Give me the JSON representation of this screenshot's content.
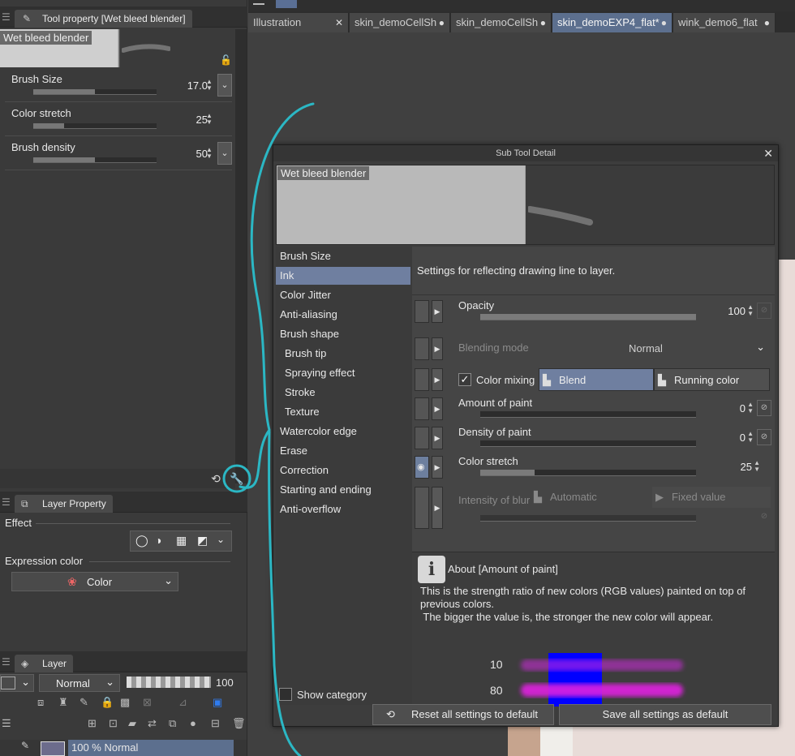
{
  "tool_property": {
    "tab_title": "Tool property [Wet bleed blender]",
    "preview_label": "Wet bleed blender",
    "props": [
      {
        "label": "Brush Size",
        "value": "17.0",
        "fill": 0.5
      },
      {
        "label": "Color stretch",
        "value": "25",
        "fill": 0.25
      },
      {
        "label": "Brush density",
        "value": "50",
        "fill": 0.5
      }
    ]
  },
  "layer_property": {
    "tab_title": "Layer Property",
    "effect_label": "Effect",
    "expression_label": "Expression color",
    "expression_value": "Color"
  },
  "layer_panel": {
    "tab_title": "Layer",
    "blend_mode": "Normal",
    "opacity": "100",
    "layer_row": "100 % Normal"
  },
  "doc_tabs": [
    {
      "label": "Illustration",
      "close": "✕",
      "active": false
    },
    {
      "label": "skin_demoCellSh",
      "close": "●",
      "active": false
    },
    {
      "label": "skin_demoCellSh",
      "close": "●",
      "active": false
    },
    {
      "label": "skin_demoEXP4_flat*",
      "close": "●",
      "active": true
    },
    {
      "label": "wink_demo6_flat",
      "close": "●",
      "active": false
    }
  ],
  "dialog": {
    "title": "Sub Tool Detail",
    "preview_label": "Wet bleed blender",
    "categories": [
      {
        "label": "Brush Size",
        "sub": false,
        "active": false
      },
      {
        "label": "Ink",
        "sub": false,
        "active": true
      },
      {
        "label": "Color Jitter",
        "sub": false,
        "active": false
      },
      {
        "label": "Anti-aliasing",
        "sub": false,
        "active": false
      },
      {
        "label": "Brush shape",
        "sub": false,
        "active": false
      },
      {
        "label": "Brush tip",
        "sub": true,
        "active": false
      },
      {
        "label": "Spraying effect",
        "sub": true,
        "active": false
      },
      {
        "label": "Stroke",
        "sub": true,
        "active": false
      },
      {
        "label": "Texture",
        "sub": true,
        "active": false
      },
      {
        "label": "Watercolor edge",
        "sub": false,
        "active": false
      },
      {
        "label": "Erase",
        "sub": false,
        "active": false
      },
      {
        "label": "Correction",
        "sub": false,
        "active": false
      },
      {
        "label": "Starting and ending",
        "sub": false,
        "active": false
      },
      {
        "label": "Anti-overflow",
        "sub": false,
        "active": false
      }
    ],
    "description": "Settings for reflecting drawing line to layer.",
    "opacity": {
      "label": "Opacity",
      "value": "100",
      "fill": 1.0
    },
    "blending": {
      "label": "Blending mode",
      "value": "Normal"
    },
    "color_mixing": {
      "label": "Color mixing",
      "blend": "Blend",
      "running": "Running color"
    },
    "amount_of_paint": {
      "label": "Amount of paint",
      "value": "0",
      "fill": 0
    },
    "density_of_paint": {
      "label": "Density of paint",
      "value": "0",
      "fill": 0
    },
    "color_stretch": {
      "label": "Color stretch",
      "value": "25",
      "fill": 0.25
    },
    "intensity_of_blur": {
      "label": "Intensity of blur",
      "automatic": "Automatic",
      "fixed": "Fixed value"
    },
    "about": {
      "title": "About [Amount of paint]",
      "line1": "This is the strength ratio of new colors (RGB values) painted on top of",
      "line2": "previous colors.",
      "line3": " The bigger the value is, the stronger the new color will appear.",
      "example_values": [
        "10",
        "80"
      ]
    },
    "show_category": "Show category",
    "reset_button": "Reset all settings to default",
    "save_button": "Save all settings as default"
  },
  "colors": {
    "accent": "#6f7fa0",
    "annotation": "#2bb7c4",
    "example_blue": "#0000ff",
    "example_magenta": "#e020e0"
  }
}
